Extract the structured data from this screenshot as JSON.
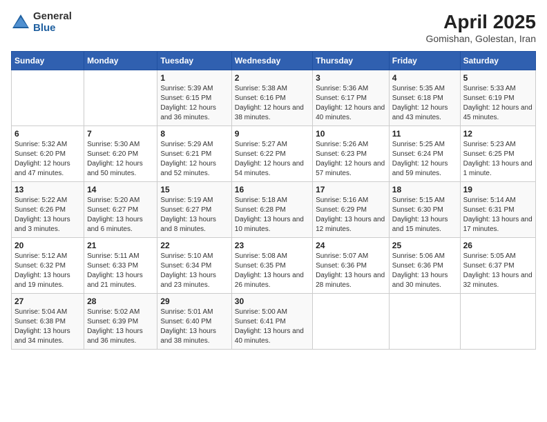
{
  "logo": {
    "general": "General",
    "blue": "Blue"
  },
  "title": "April 2025",
  "subtitle": "Gomishan, Golestan, Iran",
  "days_header": [
    "Sunday",
    "Monday",
    "Tuesday",
    "Wednesday",
    "Thursday",
    "Friday",
    "Saturday"
  ],
  "weeks": [
    [
      {
        "num": "",
        "sunrise": "",
        "sunset": "",
        "daylight": ""
      },
      {
        "num": "",
        "sunrise": "",
        "sunset": "",
        "daylight": ""
      },
      {
        "num": "1",
        "sunrise": "Sunrise: 5:39 AM",
        "sunset": "Sunset: 6:15 PM",
        "daylight": "Daylight: 12 hours and 36 minutes."
      },
      {
        "num": "2",
        "sunrise": "Sunrise: 5:38 AM",
        "sunset": "Sunset: 6:16 PM",
        "daylight": "Daylight: 12 hours and 38 minutes."
      },
      {
        "num": "3",
        "sunrise": "Sunrise: 5:36 AM",
        "sunset": "Sunset: 6:17 PM",
        "daylight": "Daylight: 12 hours and 40 minutes."
      },
      {
        "num": "4",
        "sunrise": "Sunrise: 5:35 AM",
        "sunset": "Sunset: 6:18 PM",
        "daylight": "Daylight: 12 hours and 43 minutes."
      },
      {
        "num": "5",
        "sunrise": "Sunrise: 5:33 AM",
        "sunset": "Sunset: 6:19 PM",
        "daylight": "Daylight: 12 hours and 45 minutes."
      }
    ],
    [
      {
        "num": "6",
        "sunrise": "Sunrise: 5:32 AM",
        "sunset": "Sunset: 6:20 PM",
        "daylight": "Daylight: 12 hours and 47 minutes."
      },
      {
        "num": "7",
        "sunrise": "Sunrise: 5:30 AM",
        "sunset": "Sunset: 6:20 PM",
        "daylight": "Daylight: 12 hours and 50 minutes."
      },
      {
        "num": "8",
        "sunrise": "Sunrise: 5:29 AM",
        "sunset": "Sunset: 6:21 PM",
        "daylight": "Daylight: 12 hours and 52 minutes."
      },
      {
        "num": "9",
        "sunrise": "Sunrise: 5:27 AM",
        "sunset": "Sunset: 6:22 PM",
        "daylight": "Daylight: 12 hours and 54 minutes."
      },
      {
        "num": "10",
        "sunrise": "Sunrise: 5:26 AM",
        "sunset": "Sunset: 6:23 PM",
        "daylight": "Daylight: 12 hours and 57 minutes."
      },
      {
        "num": "11",
        "sunrise": "Sunrise: 5:25 AM",
        "sunset": "Sunset: 6:24 PM",
        "daylight": "Daylight: 12 hours and 59 minutes."
      },
      {
        "num": "12",
        "sunrise": "Sunrise: 5:23 AM",
        "sunset": "Sunset: 6:25 PM",
        "daylight": "Daylight: 13 hours and 1 minute."
      }
    ],
    [
      {
        "num": "13",
        "sunrise": "Sunrise: 5:22 AM",
        "sunset": "Sunset: 6:26 PM",
        "daylight": "Daylight: 13 hours and 3 minutes."
      },
      {
        "num": "14",
        "sunrise": "Sunrise: 5:20 AM",
        "sunset": "Sunset: 6:27 PM",
        "daylight": "Daylight: 13 hours and 6 minutes."
      },
      {
        "num": "15",
        "sunrise": "Sunrise: 5:19 AM",
        "sunset": "Sunset: 6:27 PM",
        "daylight": "Daylight: 13 hours and 8 minutes."
      },
      {
        "num": "16",
        "sunrise": "Sunrise: 5:18 AM",
        "sunset": "Sunset: 6:28 PM",
        "daylight": "Daylight: 13 hours and 10 minutes."
      },
      {
        "num": "17",
        "sunrise": "Sunrise: 5:16 AM",
        "sunset": "Sunset: 6:29 PM",
        "daylight": "Daylight: 13 hours and 12 minutes."
      },
      {
        "num": "18",
        "sunrise": "Sunrise: 5:15 AM",
        "sunset": "Sunset: 6:30 PM",
        "daylight": "Daylight: 13 hours and 15 minutes."
      },
      {
        "num": "19",
        "sunrise": "Sunrise: 5:14 AM",
        "sunset": "Sunset: 6:31 PM",
        "daylight": "Daylight: 13 hours and 17 minutes."
      }
    ],
    [
      {
        "num": "20",
        "sunrise": "Sunrise: 5:12 AM",
        "sunset": "Sunset: 6:32 PM",
        "daylight": "Daylight: 13 hours and 19 minutes."
      },
      {
        "num": "21",
        "sunrise": "Sunrise: 5:11 AM",
        "sunset": "Sunset: 6:33 PM",
        "daylight": "Daylight: 13 hours and 21 minutes."
      },
      {
        "num": "22",
        "sunrise": "Sunrise: 5:10 AM",
        "sunset": "Sunset: 6:34 PM",
        "daylight": "Daylight: 13 hours and 23 minutes."
      },
      {
        "num": "23",
        "sunrise": "Sunrise: 5:08 AM",
        "sunset": "Sunset: 6:35 PM",
        "daylight": "Daylight: 13 hours and 26 minutes."
      },
      {
        "num": "24",
        "sunrise": "Sunrise: 5:07 AM",
        "sunset": "Sunset: 6:36 PM",
        "daylight": "Daylight: 13 hours and 28 minutes."
      },
      {
        "num": "25",
        "sunrise": "Sunrise: 5:06 AM",
        "sunset": "Sunset: 6:36 PM",
        "daylight": "Daylight: 13 hours and 30 minutes."
      },
      {
        "num": "26",
        "sunrise": "Sunrise: 5:05 AM",
        "sunset": "Sunset: 6:37 PM",
        "daylight": "Daylight: 13 hours and 32 minutes."
      }
    ],
    [
      {
        "num": "27",
        "sunrise": "Sunrise: 5:04 AM",
        "sunset": "Sunset: 6:38 PM",
        "daylight": "Daylight: 13 hours and 34 minutes."
      },
      {
        "num": "28",
        "sunrise": "Sunrise: 5:02 AM",
        "sunset": "Sunset: 6:39 PM",
        "daylight": "Daylight: 13 hours and 36 minutes."
      },
      {
        "num": "29",
        "sunrise": "Sunrise: 5:01 AM",
        "sunset": "Sunset: 6:40 PM",
        "daylight": "Daylight: 13 hours and 38 minutes."
      },
      {
        "num": "30",
        "sunrise": "Sunrise: 5:00 AM",
        "sunset": "Sunset: 6:41 PM",
        "daylight": "Daylight: 13 hours and 40 minutes."
      },
      {
        "num": "",
        "sunrise": "",
        "sunset": "",
        "daylight": ""
      },
      {
        "num": "",
        "sunrise": "",
        "sunset": "",
        "daylight": ""
      },
      {
        "num": "",
        "sunrise": "",
        "sunset": "",
        "daylight": ""
      }
    ]
  ]
}
